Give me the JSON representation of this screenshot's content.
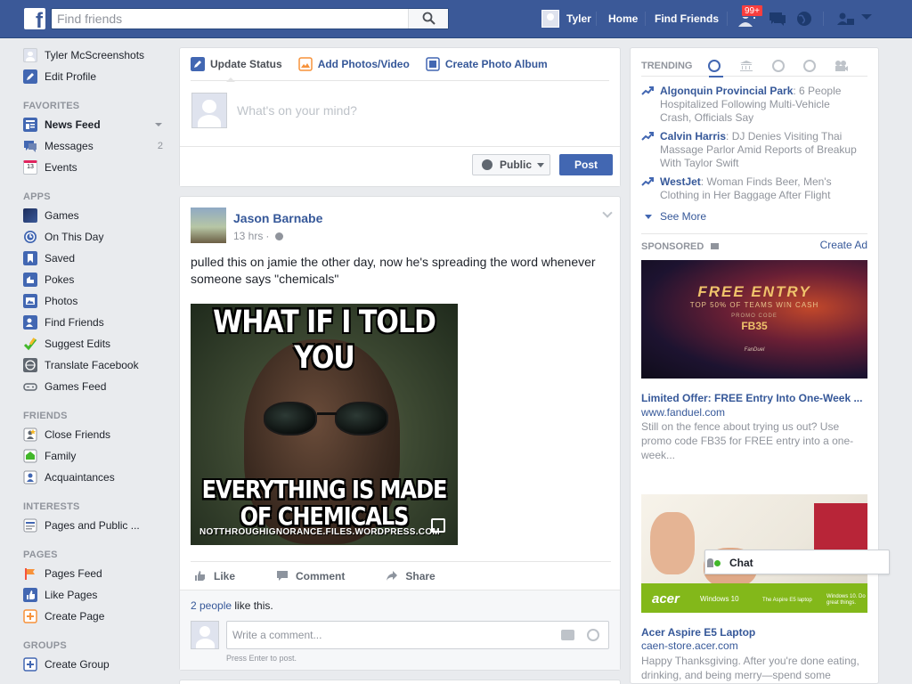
{
  "topbar": {
    "logo": "f",
    "search_placeholder": "Find friends",
    "user_name": "Tyler",
    "home": "Home",
    "find_friends": "Find Friends",
    "notif_badge": "99+",
    "icons": [
      "friend-requests-icon",
      "messages-icon",
      "notifications-globe-icon",
      "privacy-shortcuts-icon",
      "account-dropdown-icon"
    ],
    "colors": {
      "bar": "#3b5998",
      "badge": "#fa3e3e"
    }
  },
  "sidebar": {
    "profile_name": "Tyler McScreenshots",
    "edit_profile": "Edit Profile",
    "favorites_heading": "FAVORITES",
    "favorites": [
      {
        "label": "News Feed",
        "icon": "news-feed-icon"
      },
      {
        "label": "Messages",
        "count": "2",
        "icon": "messages-icon"
      },
      {
        "label": "Events",
        "icon": "events-calendar-icon",
        "icon_text": "13"
      }
    ],
    "apps_heading": "APPS",
    "apps": [
      {
        "label": "Games",
        "icon": "games-icon"
      },
      {
        "label": "On This Day",
        "icon": "on-this-day-icon"
      },
      {
        "label": "Saved",
        "icon": "saved-bookmark-icon"
      },
      {
        "label": "Pokes",
        "icon": "pokes-icon"
      },
      {
        "label": "Photos",
        "icon": "photos-icon"
      },
      {
        "label": "Find Friends",
        "icon": "find-friends-icon"
      },
      {
        "label": "Suggest Edits",
        "icon": "suggest-edits-icon"
      },
      {
        "label": "Translate Facebook",
        "icon": "translate-icon"
      },
      {
        "label": "Games Feed",
        "icon": "games-feed-controller-icon"
      }
    ],
    "friends_heading": "FRIENDS",
    "friends": [
      {
        "label": "Close Friends",
        "icon": "close-friends-icon"
      },
      {
        "label": "Family",
        "icon": "family-icon"
      },
      {
        "label": "Acquaintances",
        "icon": "acquaintances-icon"
      }
    ],
    "interests_heading": "INTERESTS",
    "interests": [
      {
        "label": "Pages and Public ...",
        "icon": "pages-feed-icon"
      }
    ],
    "pages_heading": "PAGES",
    "pages": [
      {
        "label": "Pages Feed",
        "icon": "pages-feed-flag-icon"
      },
      {
        "label": "Like Pages",
        "icon": "like-pages-icon"
      },
      {
        "label": "Create Page",
        "icon": "create-page-icon"
      }
    ],
    "groups_heading": "GROUPS",
    "groups": [
      {
        "label": "Create Group",
        "icon": "create-group-icon"
      }
    ]
  },
  "composer": {
    "tabs": [
      {
        "label": "Update Status",
        "icon": "pencil-icon"
      },
      {
        "label": "Add Photos/Video",
        "icon": "photo-video-icon"
      },
      {
        "label": "Create Photo Album",
        "icon": "photo-album-icon"
      }
    ],
    "placeholder": "What's on your mind?",
    "privacy": "Public",
    "post_button": "Post"
  },
  "post": {
    "author": "Jason Barnabe",
    "time": "13 hrs",
    "text": "pulled this on jamie the other day, now he's spreading the word whenever someone says \"chemicals\"",
    "meme_top": "WHAT IF I TOLD YOU",
    "meme_bottom": "EVERYTHING IS MADE OF CHEMICALS",
    "image_caption": "NOTTHROUGHIGNORANCE.FILES.WORDPRESS.COM",
    "actions": {
      "like": "Like",
      "comment": "Comment",
      "share": "Share"
    },
    "likes_link": "2 people",
    "likes_suffix": " like this.",
    "comment_placeholder": "Write a comment...",
    "comment_hint": "Press Enter to post."
  },
  "trending": {
    "heading": "TRENDING",
    "tab_icons": [
      "top-trends-icon",
      "politics-icon",
      "science-tech-icon",
      "sports-icon",
      "entertainment-icon"
    ],
    "items": [
      {
        "title": "Algonquin Provincial Park",
        "desc": ": 6 People Hospitalized Following Multi-Vehicle Crash, Officials Say"
      },
      {
        "title": "Calvin Harris",
        "desc": ": DJ Denies Visiting Thai Massage Parlor Amid Reports of Breakup With Taylor Swift"
      },
      {
        "title": "WestJet",
        "desc": ": Woman Finds Beer, Men's Clothing in Her Baggage After Flight"
      }
    ],
    "see_more": "See More"
  },
  "sponsored": {
    "heading": "SPONSORED",
    "create_ad": "Create Ad",
    "ads": [
      {
        "image_text": {
          "headline": "FREE ENTRY",
          "line1": "TOP 50% OF TEAMS WIN CASH",
          "line2": "PROMO CODE",
          "code": "FB35",
          "brand": "FanDuel"
        },
        "title": "Limited Offer: FREE Entry Into One-Week ...",
        "url": "www.fanduel.com",
        "body": "Still on the fence about trying us out? Use promo code FB35 for FREE entry into a one-week..."
      },
      {
        "image_text": {
          "brand": "acer",
          "os": "Windows 10",
          "caption": "The Aspire E5 laptop",
          "tagline": "Windows 10. Do great things."
        },
        "title": "Acer Aspire E5 Laptop",
        "url": "caen-store.acer.com",
        "body": "Happy Thanksgiving. After you're done eating, drinking, and being merry—spend some"
      }
    ]
  },
  "chat": {
    "label": "Chat"
  }
}
